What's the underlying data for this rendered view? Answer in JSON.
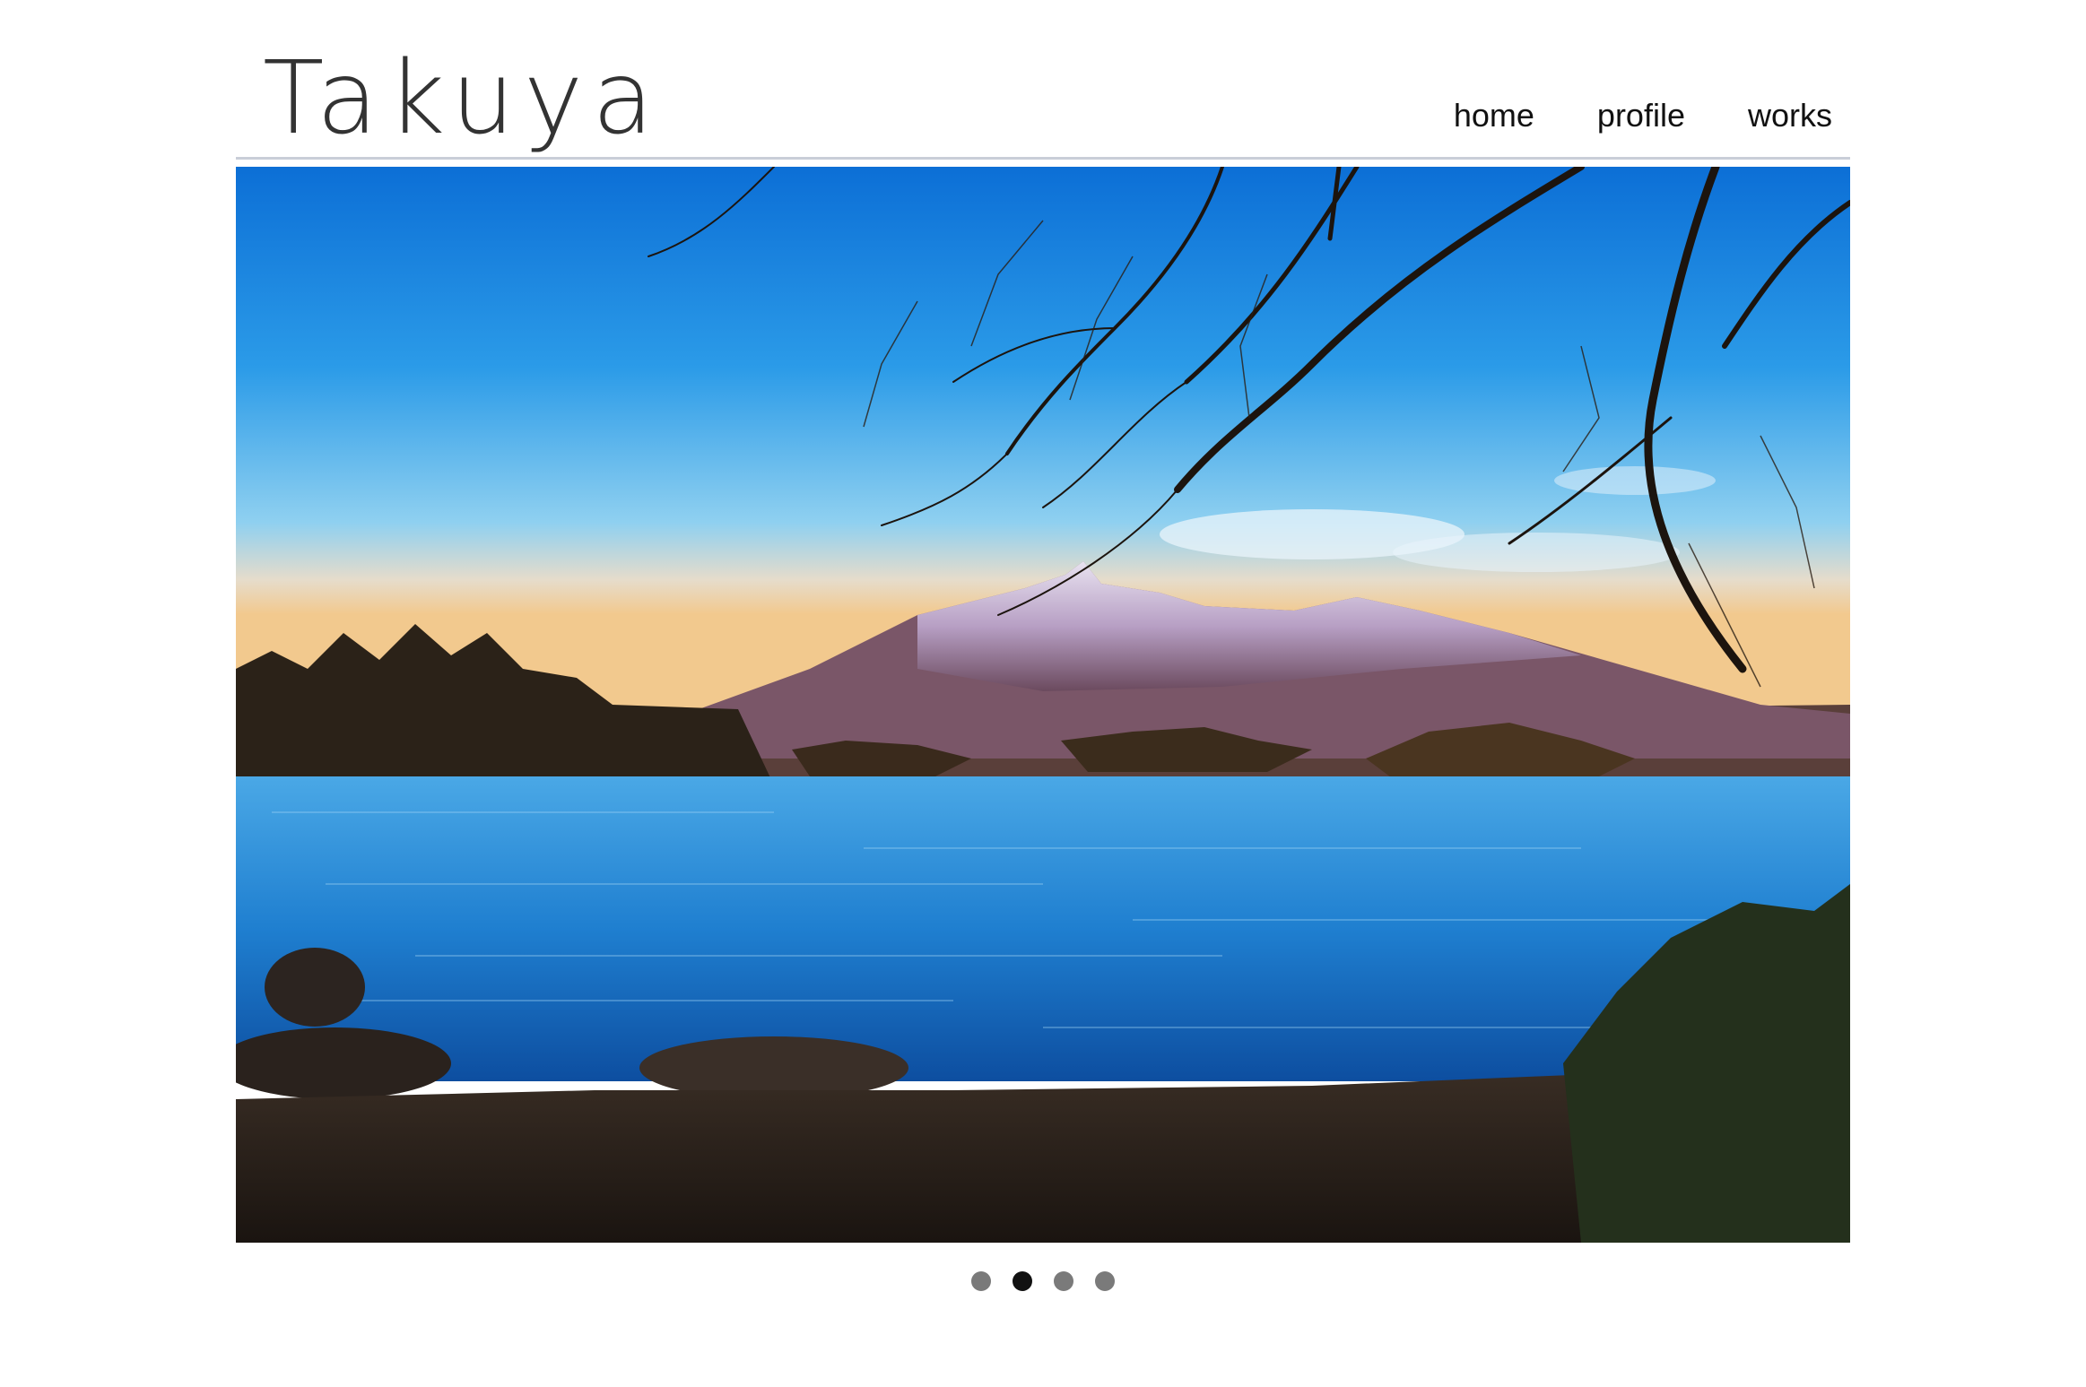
{
  "site": {
    "logo_text": "Takuya"
  },
  "nav": {
    "items": [
      {
        "label": "home"
      },
      {
        "label": "profile"
      },
      {
        "label": "works"
      }
    ]
  },
  "slider": {
    "image_icon": "landscape-photo",
    "slide_count": 4,
    "active_index": 1
  },
  "colors": {
    "rule": "#c9ced8",
    "dot_inactive": "#7a7a7a",
    "dot_active": "#111111"
  }
}
